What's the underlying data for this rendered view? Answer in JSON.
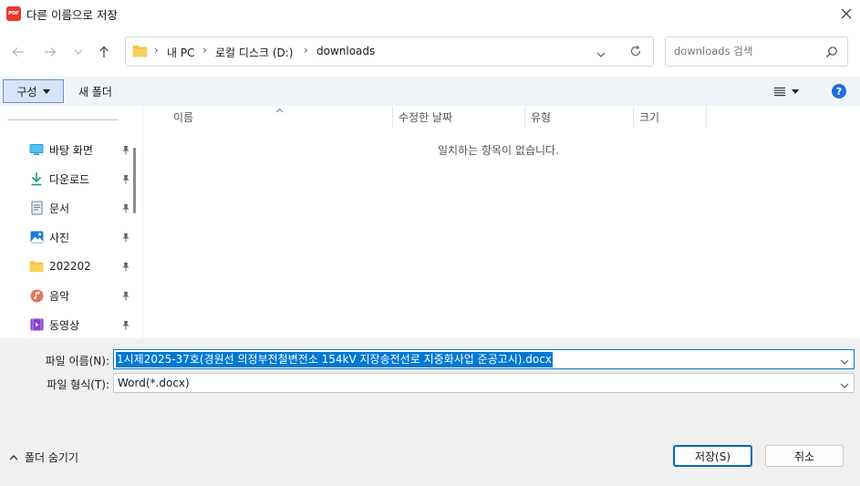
{
  "window": {
    "app_icon_text": "PDF",
    "title": "다른 이름으로 저장"
  },
  "address": {
    "crumbs": [
      "내 PC",
      "로컬 디스크 (D:)",
      "downloads"
    ]
  },
  "search": {
    "placeholder": "downloads 검색"
  },
  "toolbar": {
    "organize_label": "구성",
    "new_folder_label": "새 폴더",
    "help_label": "?"
  },
  "sidebar": {
    "items": [
      {
        "label": "바탕 화면",
        "icon": "desktop-icon",
        "pinned": true
      },
      {
        "label": "다운로드",
        "icon": "download-icon",
        "pinned": true
      },
      {
        "label": "문서",
        "icon": "document-icon",
        "pinned": true
      },
      {
        "label": "사진",
        "icon": "picture-icon",
        "pinned": true
      },
      {
        "label": "202202",
        "icon": "folder-icon",
        "pinned": true
      },
      {
        "label": "음악",
        "icon": "music-icon",
        "pinned": true
      },
      {
        "label": "동영상",
        "icon": "video-icon",
        "pinned": true
      }
    ]
  },
  "columns": [
    "이름",
    "수정한 날짜",
    "유형",
    "크기"
  ],
  "empty_message": "일치하는 항목이 없습니다.",
  "form": {
    "filename_label": "파일 이름(N):",
    "filename_value": "1시제2025-37호(경원선 의정부전철변전소 154kV 지장송전선로 지중화사업 준공고시).docx",
    "filetype_label": "파일 형식(T):",
    "filetype_value": "Word(*.docx)"
  },
  "footer": {
    "hide_folders_label": "폴더 숨기기",
    "save_label": "저장(S)",
    "cancel_label": "취소"
  },
  "colors": {
    "accent": "#0078d4",
    "toolbar_bg": "#f0f4f9",
    "panel_bg": "#f0f0f0",
    "pdf_red": "#e8382f"
  }
}
